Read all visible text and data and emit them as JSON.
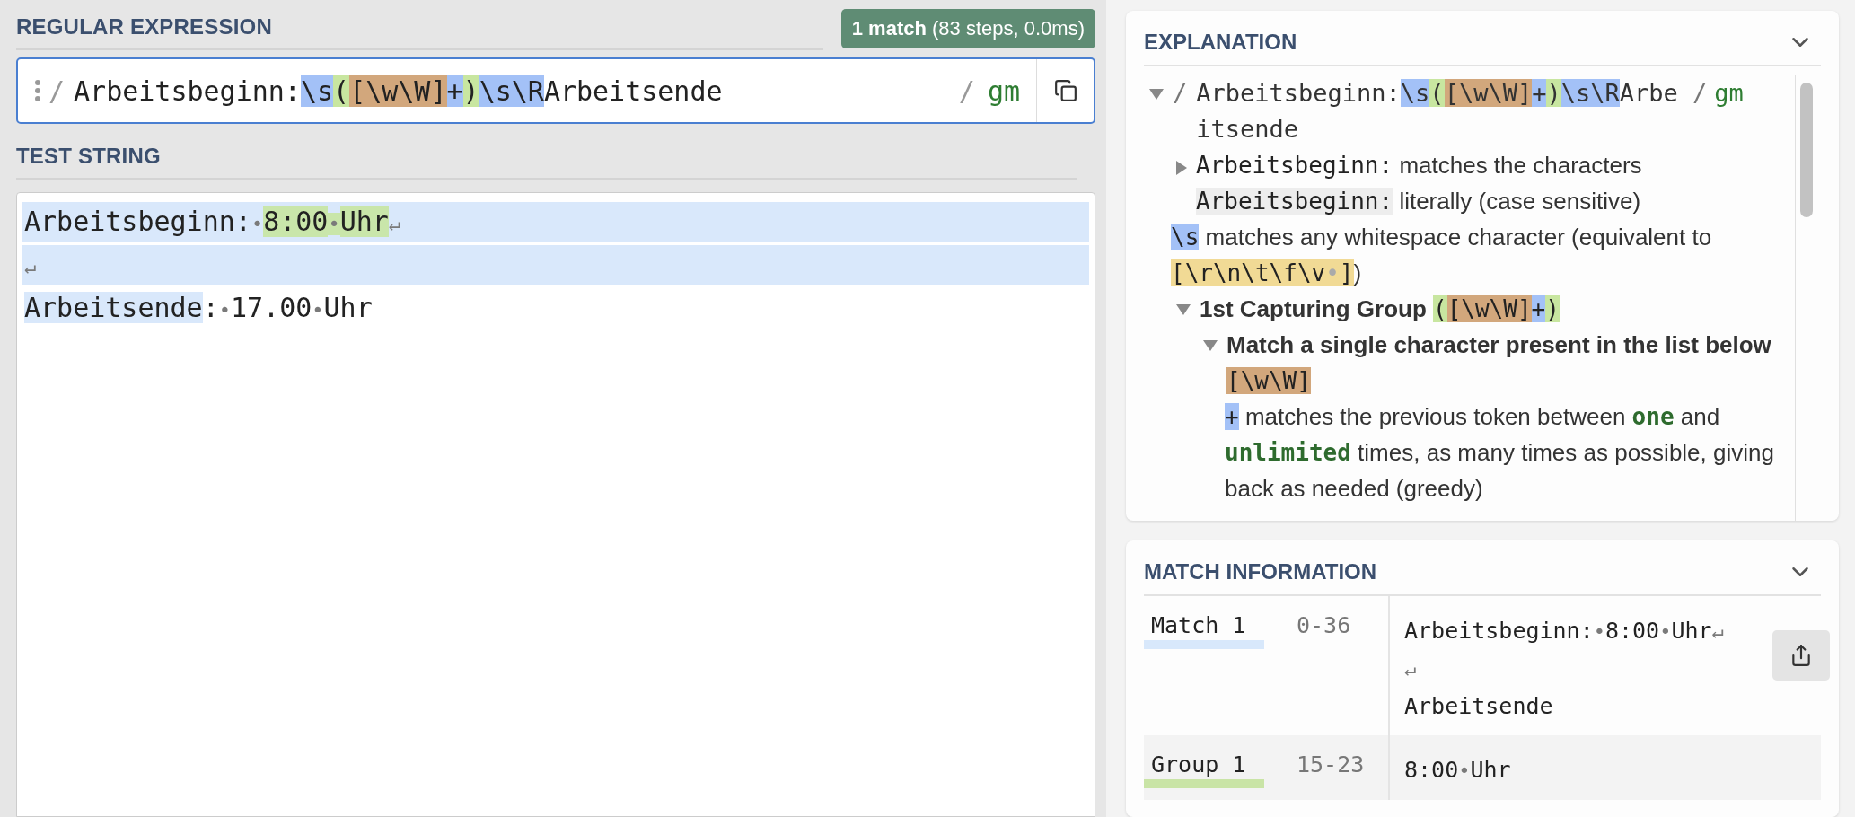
{
  "regex_panel": {
    "title": "REGULAR EXPRESSION",
    "badge": "**1 match** (83 steps, 0.0ms)",
    "delimiter": "/",
    "tokens": [
      {
        "text": "Arbeitsbeginn:",
        "kind": "literal"
      },
      {
        "text": "\\s",
        "kind": "escape"
      },
      {
        "text": "(",
        "kind": "group"
      },
      {
        "text": "[\\w\\W]",
        "kind": "class"
      },
      {
        "text": "+",
        "kind": "quant"
      },
      {
        "text": ")",
        "kind": "group"
      },
      {
        "text": "\\s\\R",
        "kind": "escape"
      },
      {
        "text": "Arbeitsende",
        "kind": "literal"
      }
    ],
    "closing_delimiter": "/",
    "flags": "gm"
  },
  "test_string": {
    "title": "TEST STRING",
    "lines": [
      {
        "full_match": true,
        "segments": [
          {
            "text": "Arbeitsbeginn:",
            "kind": "text",
            "grouped": false
          },
          {
            "text": "•",
            "kind": "ws",
            "grouped": false
          },
          {
            "text": "8:00",
            "kind": "text",
            "grouped": true
          },
          {
            "text": "•",
            "kind": "ws",
            "grouped": true
          },
          {
            "text": "Uhr",
            "kind": "text",
            "grouped": true
          },
          {
            "text": "↵",
            "kind": "ws",
            "grouped": false
          }
        ]
      },
      {
        "full_match": true,
        "segments": [
          {
            "text": "↵",
            "kind": "ws"
          }
        ]
      },
      {
        "full_match": false,
        "segments": [
          {
            "text": "Arbeitsende",
            "kind": "text",
            "matched": true,
            "grouped": false
          },
          {
            "text": ":",
            "kind": "text",
            "matched": false,
            "grouped": false
          },
          {
            "text": "•",
            "kind": "ws",
            "matched": false,
            "grouped": false
          },
          {
            "text": "17.00",
            "kind": "text",
            "matched": false,
            "grouped": false
          },
          {
            "text": "•",
            "kind": "ws",
            "matched": false,
            "grouped": false
          },
          {
            "text": "Uhr",
            "kind": "text",
            "matched": false,
            "grouped": false
          }
        ]
      }
    ]
  },
  "explanation": {
    "title": "EXPLANATION",
    "root": {
      "expanded": true,
      "delimiter": "/",
      "tokens": [
        {
          "text": "Arbeitsbeginn:",
          "kind": "literal"
        },
        {
          "text": "\\s",
          "kind": "escape"
        },
        {
          "text": "(",
          "kind": "group"
        },
        {
          "text": "[\\w\\W]",
          "kind": "class"
        },
        {
          "text": "+",
          "kind": "quant"
        },
        {
          "text": ")",
          "kind": "group"
        },
        {
          "text": "\\s\\R",
          "kind": "escape"
        },
        {
          "text": "Arbeitsende",
          "kind": "literal"
        }
      ],
      "closing_delimiter": "/",
      "flags": "gm",
      "children": [
        {
          "kind": "collapsible",
          "expanded": false,
          "parts": [
            {
              "text": "Arbeitsbeginn:",
              "kind": "literal"
            },
            {
              "text": " matches the characters ",
              "kind": "text"
            },
            {
              "text": "Arbeitsbeginn:",
              "kind": "code"
            },
            {
              "text": " literally (case sensitive)",
              "kind": "text"
            }
          ]
        },
        {
          "kind": "leaf",
          "parts": [
            {
              "text": "\\s",
              "kind": "escape"
            },
            {
              "text": " matches any whitespace character (equivalent to ",
              "kind": "text"
            },
            {
              "text": "[\\r\\n\\t\\f\\v",
              "kind": "set"
            },
            {
              "text": "•",
              "kind": "set_ws"
            },
            {
              "text": "]",
              "kind": "set"
            },
            {
              "text": ")",
              "kind": "text"
            }
          ]
        },
        {
          "kind": "collapsible",
          "expanded": true,
          "parts": [
            {
              "text": "1st Capturing Group ",
              "kind": "heading"
            },
            {
              "text": "(",
              "kind": "group"
            },
            {
              "text": "[\\w\\W]",
              "kind": "class"
            },
            {
              "text": "+",
              "kind": "quant"
            },
            {
              "text": ")",
              "kind": "group"
            }
          ],
          "children": [
            {
              "kind": "collapsible",
              "expanded": true,
              "parts": [
                {
                  "text": "Match a single character present in the list below ",
                  "kind": "heading"
                },
                {
                  "text": "[\\w\\W]",
                  "kind": "class"
                }
              ],
              "children": [
                {
                  "kind": "leaf",
                  "parts": [
                    {
                      "text": "+",
                      "kind": "quant"
                    },
                    {
                      "text": " matches the previous token between ",
                      "kind": "text"
                    },
                    {
                      "text": "one",
                      "kind": "keyword"
                    },
                    {
                      "text": " and ",
                      "kind": "text"
                    },
                    {
                      "text": "unlimited",
                      "kind": "keyword"
                    },
                    {
                      "text": " times, as many times as possible, giving back as needed (greedy)",
                      "kind": "text"
                    }
                  ]
                }
              ]
            }
          ]
        }
      ]
    }
  },
  "match_information": {
    "title": "MATCH INFORMATION",
    "rows": [
      {
        "label": "Match 1",
        "range": "0-36",
        "color": "#d8e8fb",
        "lines": [
          [
            {
              "text": "Arbeitsbeginn:",
              "kind": "text"
            },
            {
              "text": "•",
              "kind": "ws"
            },
            {
              "text": "8:00",
              "kind": "text"
            },
            {
              "text": "•",
              "kind": "ws"
            },
            {
              "text": "Uhr",
              "kind": "text"
            },
            {
              "text": "↵",
              "kind": "ws"
            }
          ],
          [
            {
              "text": "↵",
              "kind": "ws"
            }
          ],
          [
            {
              "text": "Arbeitsende",
              "kind": "text"
            }
          ]
        ]
      },
      {
        "label": "Group 1",
        "range": "15-23",
        "color": "#c9e4a6",
        "lines": [
          [
            {
              "text": "8:00",
              "kind": "text"
            },
            {
              "text": "•",
              "kind": "ws"
            },
            {
              "text": "Uhr",
              "kind": "text"
            }
          ]
        ]
      }
    ]
  }
}
